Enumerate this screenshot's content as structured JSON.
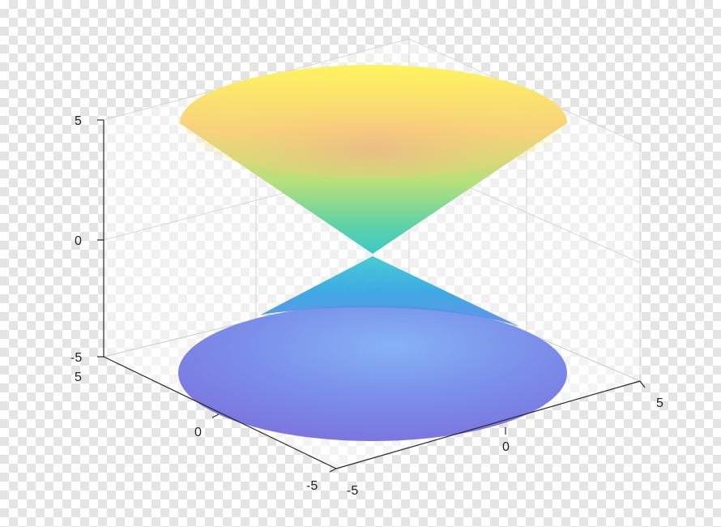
{
  "chart_data": {
    "type": "surface3d",
    "title": "",
    "surfaces": [
      {
        "name": "",
        "equation": "z = sqrt(x^2 + y^2)",
        "z_range": [
          0,
          5
        ]
      },
      {
        "name": "",
        "equation": "z = -sqrt(x^2 + y^2)",
        "z_range": [
          -5,
          0
        ]
      }
    ],
    "xlim": [
      -5,
      5
    ],
    "ylim": [
      -5,
      5
    ],
    "zlim": [
      -5,
      5
    ],
    "z_ticks": [
      "5",
      "0",
      "-5"
    ],
    "x_ticks": [
      "5",
      "0",
      "-5"
    ],
    "y_ticks": [
      "5",
      "0",
      "-5"
    ],
    "colormap": "parula",
    "grid": true
  },
  "colors": {
    "top_rim": "#fff35c",
    "top_mid": "#f5c97c",
    "apex": "#35c9c9",
    "bottom_cone": "#3aa3e3",
    "bottom_disk": "#7d82e8"
  }
}
